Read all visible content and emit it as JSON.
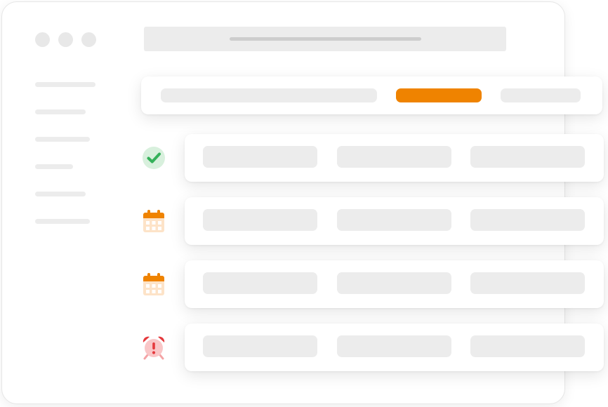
{
  "window": {
    "traffic_lights": [
      "window-dot-1",
      "window-dot-2",
      "window-dot-3"
    ]
  },
  "toolbar": {
    "primary_action_color": "#ef8300"
  },
  "rows": [
    {
      "status_icon": "checkmark-icon",
      "status_color": "#35b15a"
    },
    {
      "status_icon": "calendar-icon",
      "status_color": "#ef8300"
    },
    {
      "status_icon": "calendar-icon",
      "status_color": "#ef8300"
    },
    {
      "status_icon": "alarm-clock-alert-icon",
      "status_color": "#e5393d"
    }
  ],
  "colors": {
    "placeholder_gray": "#ececec",
    "accent_orange": "#ef8300",
    "success_green": "#35b15a",
    "alert_red": "#e5393d"
  }
}
